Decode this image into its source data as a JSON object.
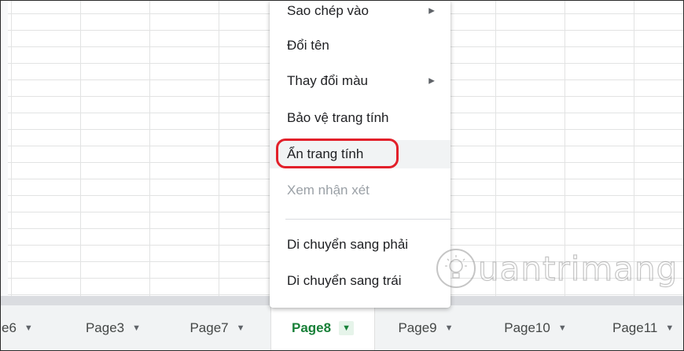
{
  "context_menu": {
    "items": [
      {
        "label": "Sao chép vào",
        "has_submenu": true,
        "state": "normal"
      },
      {
        "label": "Đổi tên",
        "has_submenu": false,
        "state": "normal"
      },
      {
        "label": "Thay đổi màu",
        "has_submenu": true,
        "state": "normal"
      },
      {
        "label": "Bảo vệ trang tính",
        "has_submenu": false,
        "state": "normal"
      },
      {
        "label": "Ẩn trang tính",
        "has_submenu": false,
        "state": "hovered"
      },
      {
        "label": "Xem nhận xét",
        "has_submenu": false,
        "state": "disabled"
      },
      {
        "label": "Di chuyển sang phải",
        "has_submenu": false,
        "state": "normal"
      },
      {
        "label": "Di chuyển sang trái",
        "has_submenu": false,
        "state": "normal"
      }
    ],
    "submenu_icon": "triangle-right-icon"
  },
  "sheet_tabs": [
    {
      "label": "e6",
      "active": false
    },
    {
      "label": "Page3",
      "active": false
    },
    {
      "label": "Page7",
      "active": false
    },
    {
      "label": "Page8",
      "active": true
    },
    {
      "label": "Page9",
      "active": false
    },
    {
      "label": "Page10",
      "active": false
    },
    {
      "label": "Page11",
      "active": false
    }
  ],
  "tab_dropdown_icon": "caret-down-icon",
  "highlight_color": "#e2202a",
  "active_tab_color": "#188038",
  "watermark": {
    "text": "uantrimang",
    "logo": "bulb-icon"
  }
}
